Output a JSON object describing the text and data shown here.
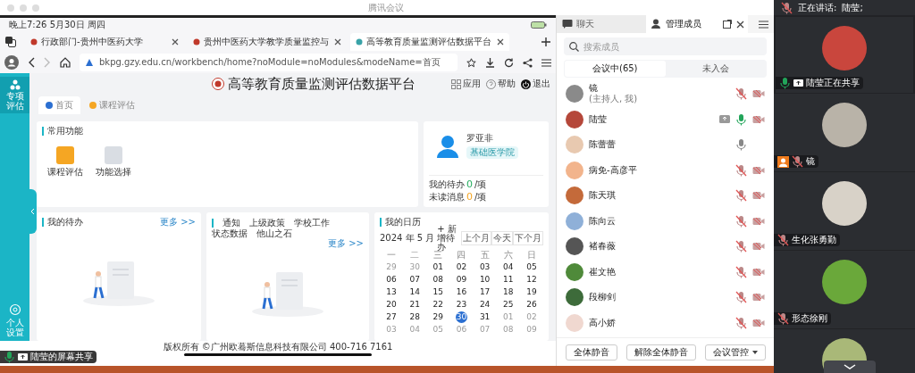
{
  "window": {
    "title": "腾讯会议"
  },
  "shared_screen": {
    "status_bar": {
      "time": "晚上7:26  5月30日 周四"
    },
    "browser_tabs": [
      {
        "title": "行政部门-贵州中医药大学",
        "selected": false
      },
      {
        "title": "贵州中医药大学教学质量监控与",
        "selected": false
      },
      {
        "title": "高等教育质量监测评估数据平台",
        "selected": true
      }
    ],
    "address": "bkpg.gzy.edu.cn/workbench/home?noModule=noModules&modeName=首页",
    "page": {
      "platform_title": "高等教育质量监测评估数据平台",
      "header_links": [
        "应用",
        "帮助",
        "退出"
      ],
      "sidebar": {
        "top_item": "专项评估",
        "bottom_item": "个人设置"
      },
      "page_tabs": [
        {
          "label": "首页",
          "selected": true
        },
        {
          "label": "课程评估",
          "selected": false
        }
      ],
      "common_functions": {
        "title": "常用功能",
        "items": [
          {
            "label": "课程评估",
            "color": "#f5a623"
          },
          {
            "label": "功能选择",
            "color": "#d9dde3"
          }
        ]
      },
      "profile": {
        "name": "罗亚非",
        "department": "基础医学院",
        "todo_label": "我的待办",
        "todo_count": "0",
        "todo_unit": "/项",
        "unread_label": "未读消息",
        "unread_count": "0",
        "unread_unit": "/项"
      },
      "todo": {
        "title": "我的待办",
        "more": "更多 >>"
      },
      "notices": {
        "tabs": [
          "通知",
          "上级政策",
          "学校工作",
          "状态数据",
          "他山之石"
        ],
        "more": "更多 >>"
      },
      "calendar": {
        "title": "我的日历",
        "month": "2024 年 5 月",
        "add": "+ 新增待办",
        "nav": [
          "上个月",
          "今天",
          "下个月"
        ],
        "weekdays": [
          "一",
          "二",
          "三",
          "四",
          "五",
          "六",
          "日"
        ],
        "weeks": [
          [
            {
              "day": "29",
              "in_month": false,
              "today": false
            },
            {
              "day": "30",
              "in_month": false,
              "today": false
            },
            {
              "day": "01",
              "in_month": true,
              "today": false
            },
            {
              "day": "02",
              "in_month": true,
              "today": false
            },
            {
              "day": "03",
              "in_month": true,
              "today": false
            },
            {
              "day": "04",
              "in_month": true,
              "today": false
            },
            {
              "day": "05",
              "in_month": true,
              "today": false
            }
          ],
          [
            {
              "day": "06",
              "in_month": true,
              "today": false
            },
            {
              "day": "07",
              "in_month": true,
              "today": false
            },
            {
              "day": "08",
              "in_month": true,
              "today": false
            },
            {
              "day": "09",
              "in_month": true,
              "today": false
            },
            {
              "day": "10",
              "in_month": true,
              "today": false
            },
            {
              "day": "11",
              "in_month": true,
              "today": false
            },
            {
              "day": "12",
              "in_month": true,
              "today": false
            }
          ],
          [
            {
              "day": "13",
              "in_month": true,
              "today": false
            },
            {
              "day": "14",
              "in_month": true,
              "today": false
            },
            {
              "day": "15",
              "in_month": true,
              "today": false
            },
            {
              "day": "16",
              "in_month": true,
              "today": false
            },
            {
              "day": "17",
              "in_month": true,
              "today": false
            },
            {
              "day": "18",
              "in_month": true,
              "today": false
            },
            {
              "day": "19",
              "in_month": true,
              "today": false
            }
          ],
          [
            {
              "day": "20",
              "in_month": true,
              "today": false
            },
            {
              "day": "21",
              "in_month": true,
              "today": false
            },
            {
              "day": "22",
              "in_month": true,
              "today": false
            },
            {
              "day": "23",
              "in_month": true,
              "today": false
            },
            {
              "day": "24",
              "in_month": true,
              "today": false
            },
            {
              "day": "25",
              "in_month": true,
              "today": false
            },
            {
              "day": "26",
              "in_month": true,
              "today": false
            }
          ],
          [
            {
              "day": "27",
              "in_month": true,
              "today": false
            },
            {
              "day": "28",
              "in_month": true,
              "today": false
            },
            {
              "day": "29",
              "in_month": true,
              "today": false
            },
            {
              "day": "30",
              "in_month": true,
              "today": true
            },
            {
              "day": "31",
              "in_month": true,
              "today": false
            },
            {
              "day": "01",
              "in_month": false,
              "today": false
            },
            {
              "day": "02",
              "in_month": false,
              "today": false
            }
          ],
          [
            {
              "day": "03",
              "in_month": false,
              "today": false
            },
            {
              "day": "04",
              "in_month": false,
              "today": false
            },
            {
              "day": "05",
              "in_month": false,
              "today": false
            },
            {
              "day": "06",
              "in_month": false,
              "today": false
            },
            {
              "day": "07",
              "in_month": false,
              "today": false
            },
            {
              "day": "08",
              "in_month": false,
              "today": false
            },
            {
              "day": "09",
              "in_month": false,
              "today": false
            }
          ]
        ]
      },
      "footer": "版权所有 ©广州欧蓦斯信息科技有限公司 400-716 7161"
    },
    "share_label": "陆莹的屏幕共享"
  },
  "member_panel": {
    "tabs": [
      {
        "label": "聊天",
        "selected": false
      },
      {
        "label": "管理成员",
        "selected": true
      }
    ],
    "search_placeholder": "搜索成员",
    "segments": [
      {
        "label": "会议中(65)",
        "selected": true
      },
      {
        "label": "未入会",
        "selected": false
      }
    ],
    "members": [
      {
        "name": "镜",
        "note": "(主持人, 我)",
        "color": "#8a8a8a",
        "muted": true,
        "speaking": false,
        "camera_off": true,
        "sharing": false
      },
      {
        "name": "陆莹",
        "color": "#b5473a",
        "muted": false,
        "speaking": true,
        "camera_off": true,
        "sharing": true
      },
      {
        "name": "陈蕾蕾",
        "color": "#e8c9b0",
        "muted": false,
        "speaking": false,
        "camera_off": false,
        "sharing": false
      },
      {
        "name": "病免-高彦平",
        "color": "#f2b48c",
        "muted": true,
        "speaking": false,
        "camera_off": true,
        "sharing": false
      },
      {
        "name": "陈天琪",
        "color": "#c46a3a",
        "muted": true,
        "speaking": false,
        "camera_off": true,
        "sharing": false
      },
      {
        "name": "陈向云",
        "color": "#8fb0d8",
        "muted": true,
        "speaking": false,
        "camera_off": true,
        "sharing": false
      },
      {
        "name": "褚春薇",
        "color": "#555555",
        "muted": true,
        "speaking": false,
        "camera_off": true,
        "sharing": false
      },
      {
        "name": "崔文艳",
        "color": "#4f8a3a",
        "muted": true,
        "speaking": false,
        "camera_off": true,
        "sharing": false
      },
      {
        "name": "段柳剑",
        "color": "#3d6b3a",
        "muted": true,
        "speaking": false,
        "camera_off": true,
        "sharing": false
      },
      {
        "name": "高小娇",
        "color": "#f0d8d0",
        "muted": true,
        "speaking": false,
        "camera_off": true,
        "sharing": false
      }
    ],
    "buttons": [
      "全体静音",
      "解除全体静音",
      "会议管控"
    ]
  },
  "video_strip": {
    "speaking_label": "正在讲话:",
    "speaker": "陆莹;",
    "tiles": [
      {
        "name": "陆莹正在共享",
        "color": "#c9463d",
        "muted": false,
        "speaking": true,
        "sharing": true,
        "active": true,
        "host": false
      },
      {
        "name": "镜",
        "color": "#b9b3a8",
        "muted": true,
        "speaking": false,
        "sharing": false,
        "active": false,
        "host": true
      },
      {
        "name": "生化张勇勤",
        "color": "#d8d2c8",
        "muted": true,
        "speaking": false,
        "sharing": false,
        "active": false,
        "host": false
      },
      {
        "name": "形态徐刚",
        "color": "#6aa83a",
        "muted": true,
        "speaking": false,
        "sharing": false,
        "active": false,
        "host": false
      },
      {
        "color": "#a9b878",
        "active": false
      }
    ]
  }
}
